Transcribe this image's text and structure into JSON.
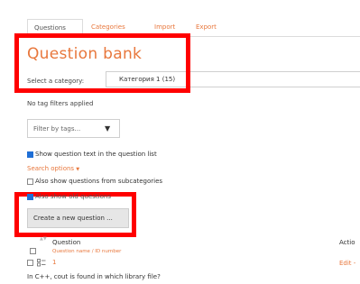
{
  "tabs": [
    {
      "label": "Questions",
      "active": true
    },
    {
      "label": "Categories",
      "active": false
    },
    {
      "label": "Import",
      "active": false
    },
    {
      "label": "Export",
      "active": false
    }
  ],
  "title": "Question bank",
  "category": {
    "label": "Select a category:",
    "value": "Категория 1 (15)"
  },
  "tag_filter": {
    "status": "No tag filters applied",
    "placeholder": "Filter by tags...",
    "caret_icon": "caret-down-icon"
  },
  "options": {
    "show_question_text": "Show question text in the question list",
    "search_options": "Search options",
    "show_from_subcategories": "Also show questions from subcategories",
    "show_old": "Also show old questions"
  },
  "create_button": "Create a new question ...",
  "table": {
    "question_header": "Question",
    "question_subheader": "Question name / ID number",
    "actions_header": "Actio",
    "row": {
      "number": "1",
      "edit": "Edit -",
      "text": "In C++, cout is found in which library file?"
    }
  },
  "colors": {
    "accent": "#e8773c",
    "highlight_box": "#ff0000",
    "checkbox_on": "#1f6fd6"
  }
}
